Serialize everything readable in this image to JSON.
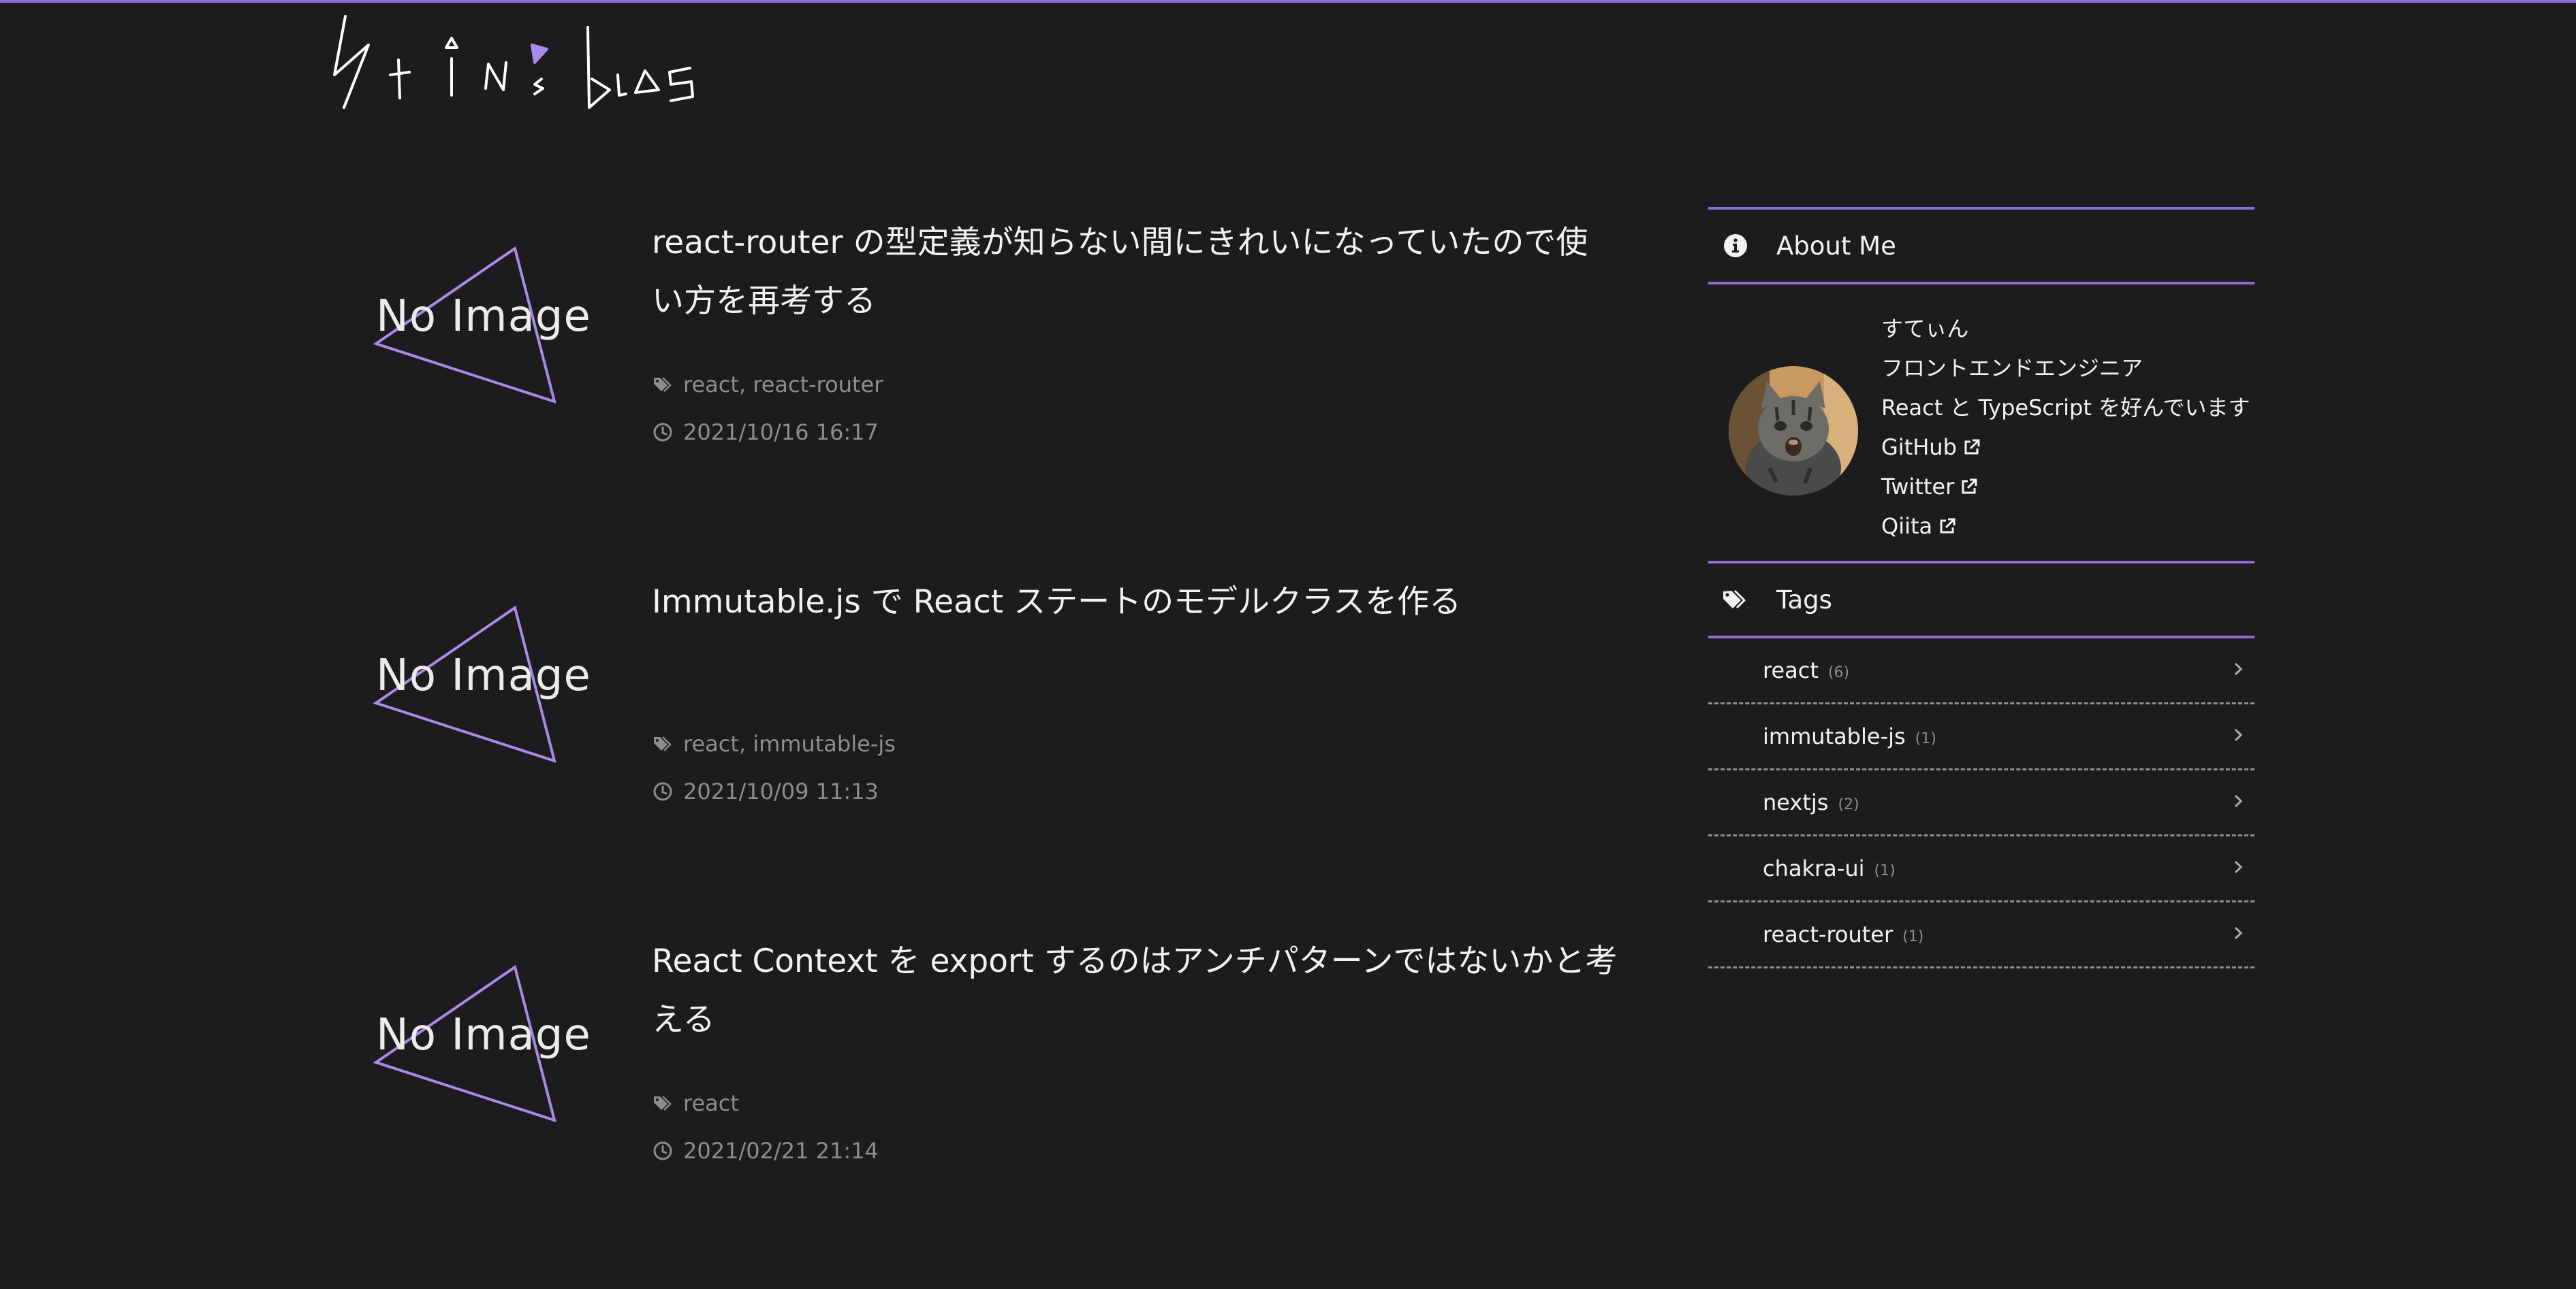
{
  "site": {
    "logo_text": "Stin's blog",
    "accent_color": "#8b6fd6",
    "background_color": "#1c1c1e"
  },
  "posts": [
    {
      "thumbnail_label": "No Image",
      "title": "react-router の型定義が知らない間にきれいになっていたので使い方を再考する",
      "tags": "react, react-router",
      "date": "2021/10/16 16:17"
    },
    {
      "thumbnail_label": "No Image",
      "title": "Immutable.js で React ステートのモデルクラスを作る",
      "tags": "react, immutable-js",
      "date": "2021/10/09 11:13"
    },
    {
      "thumbnail_label": "No Image",
      "title": "React Context を export するのはアンチパターンではないかと考える",
      "tags": "react",
      "date": "2021/02/21 21:14"
    }
  ],
  "sidebar": {
    "about": {
      "title": "About Me",
      "name": "すてぃん",
      "role": "フロントエンドエンジニア",
      "bio": "React と TypeScript を好んでいます",
      "links": [
        {
          "label": "GitHub"
        },
        {
          "label": "Twitter"
        },
        {
          "label": "Qiita"
        }
      ]
    },
    "tags": {
      "title": "Tags",
      "items": [
        {
          "name": "react",
          "count": "(6)"
        },
        {
          "name": "immutable-js",
          "count": "(1)"
        },
        {
          "name": "nextjs",
          "count": "(2)"
        },
        {
          "name": "chakra-ui",
          "count": "(1)"
        },
        {
          "name": "react-router",
          "count": "(1)"
        }
      ]
    }
  }
}
